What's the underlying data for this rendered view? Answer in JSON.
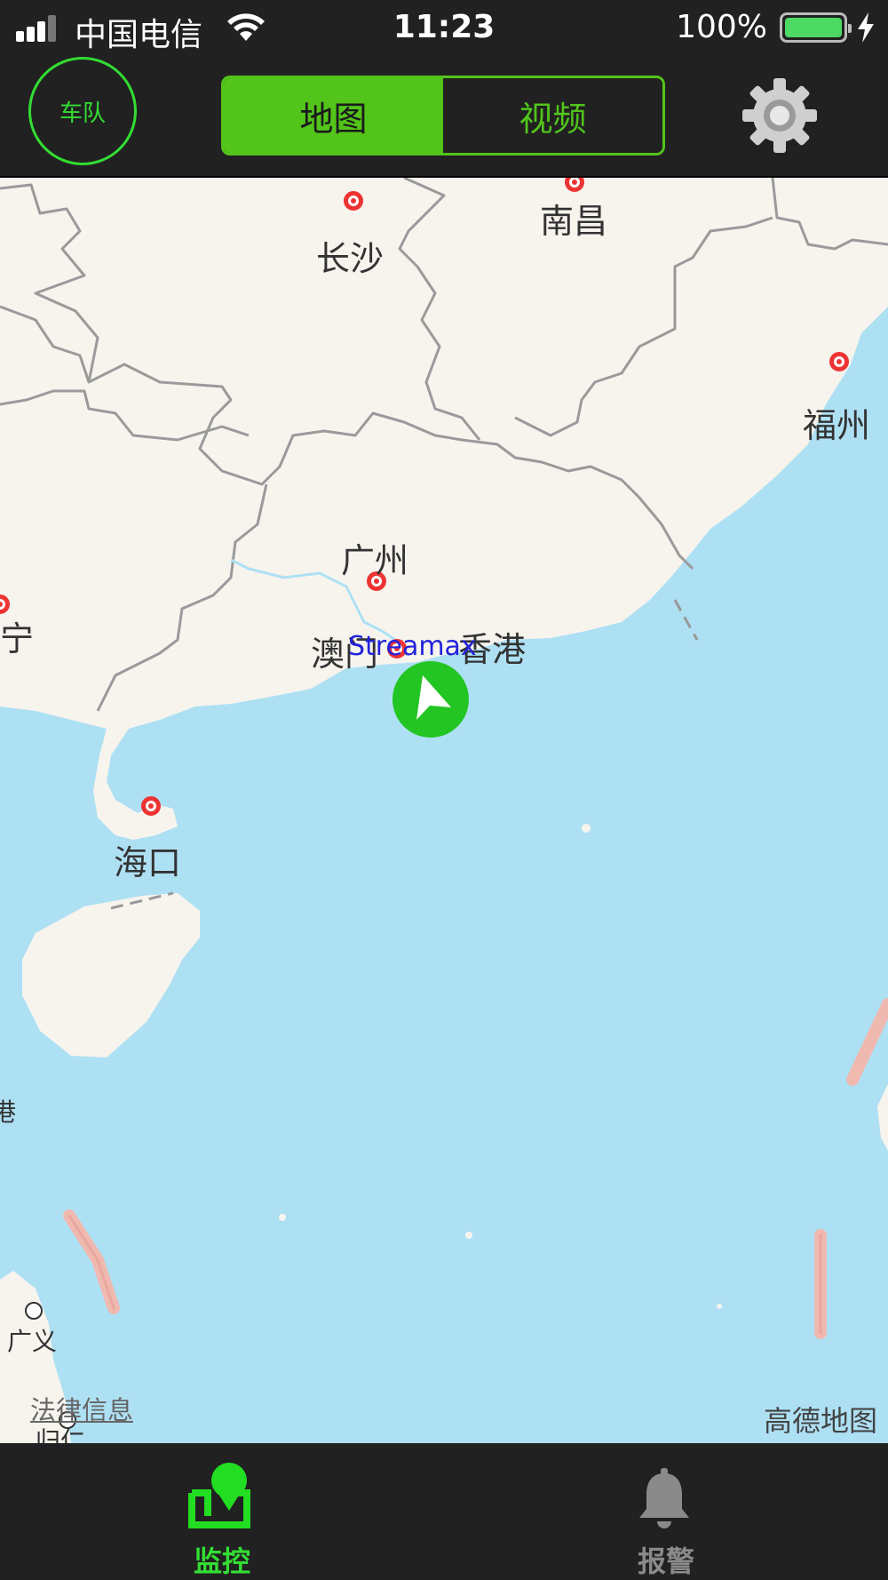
{
  "status_bar": {
    "carrier": "中国电信",
    "time": "11:23",
    "battery_percent": "100%",
    "battery_level": 1.0
  },
  "nav": {
    "fleet_button": "车队",
    "tabs": [
      {
        "label": "地图",
        "active": true
      },
      {
        "label": "视频",
        "active": false
      }
    ],
    "accent_color": "#52c41a"
  },
  "map": {
    "cities": {
      "nanchang": "南昌",
      "changsha": "长沙",
      "fuzhou": "福州",
      "guangzhou": "广州",
      "macau": "澳门",
      "hongkong": "香港",
      "haikou": "海口",
      "nanning_partial": "宁",
      "guangyi": "广义",
      "gang_partial": "港",
      "guihua_partial": "归仁"
    },
    "vehicle_label": "Streamax",
    "legal_link": "法律信息",
    "brand": "高德地图"
  },
  "tab_bar": {
    "monitor": "监控",
    "alarm": "报警",
    "active_tab": "监控"
  }
}
